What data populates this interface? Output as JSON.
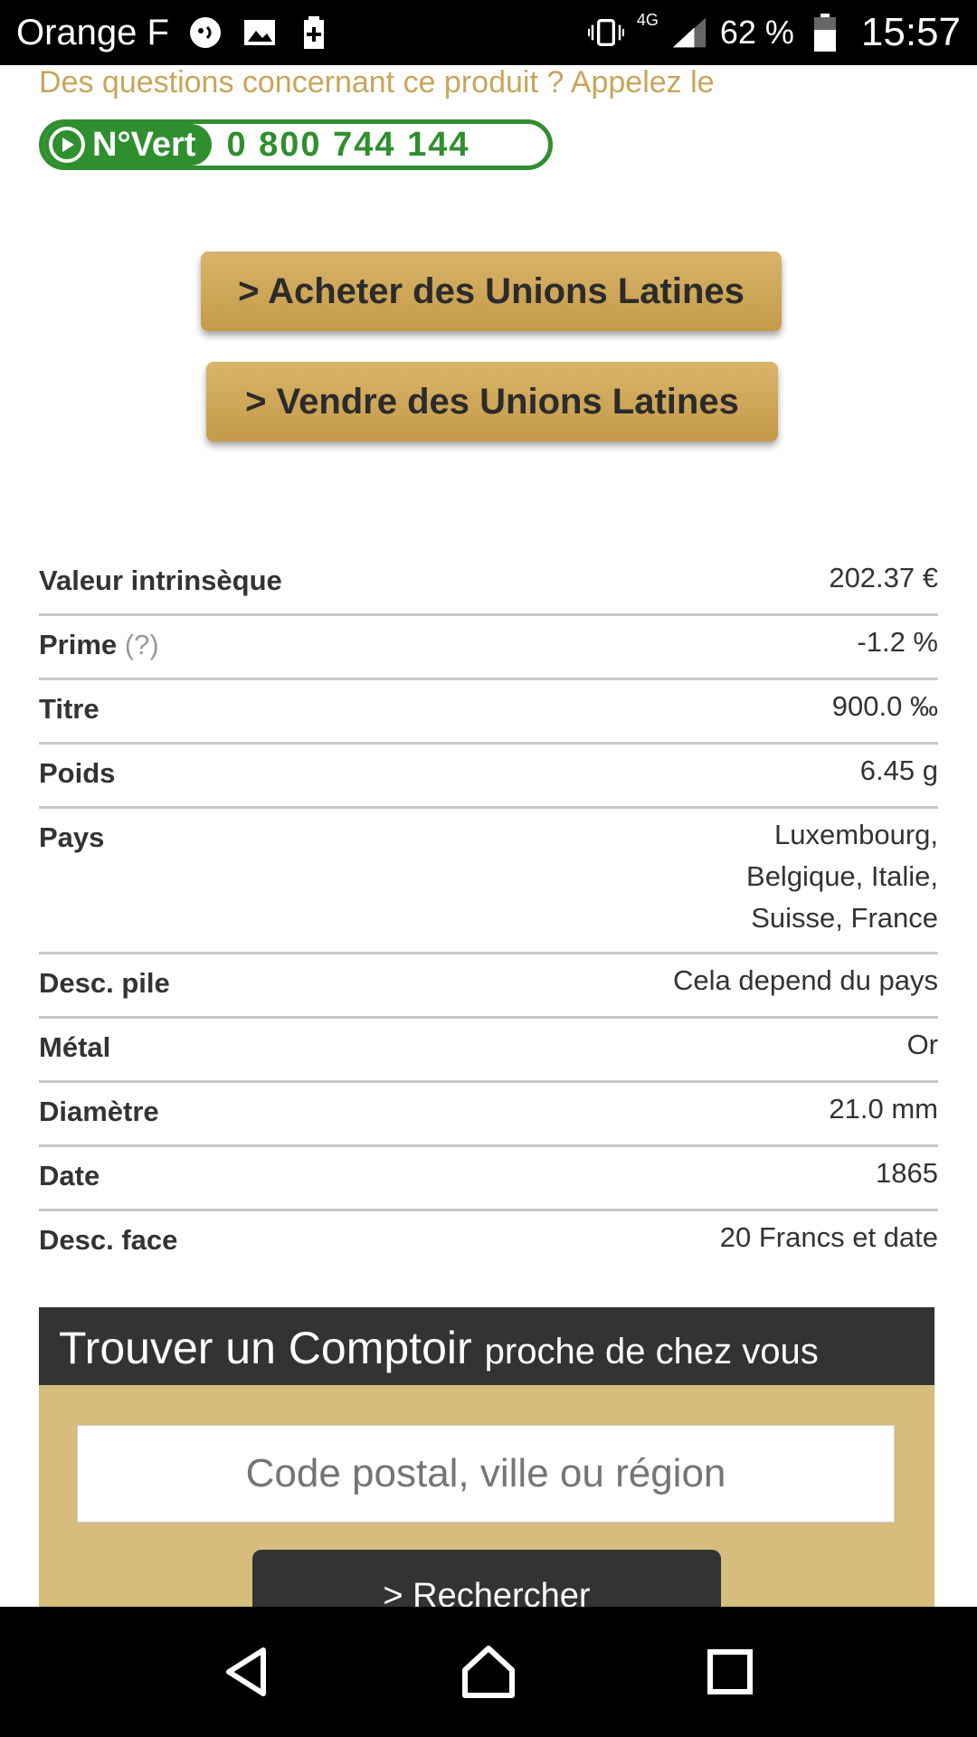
{
  "status_bar": {
    "carrier": "Orange F",
    "network": "4G",
    "battery": "62 %",
    "time": "15:57",
    "icons": [
      "messenger-icon",
      "image-icon",
      "battery-saver-icon",
      "vibrate-icon",
      "signal-icon",
      "battery-icon"
    ]
  },
  "header": {
    "question": "Des questions concernant ce produit ? Appelez le",
    "novert_label": "N°Vert",
    "novert_number": "0 800 744 144"
  },
  "actions": {
    "buy": "> Acheter des Unions Latines",
    "sell": "> Vendre des Unions Latines"
  },
  "specs": [
    {
      "label": "Valeur intrinsèque",
      "value": "202.37 €"
    },
    {
      "label": "Prime",
      "hint": "(?)",
      "value": "-1.2 %"
    },
    {
      "label": "Titre",
      "value": "900.0 ‰"
    },
    {
      "label": "Poids",
      "value": "6.45 g"
    },
    {
      "label": "Pays",
      "value_lines": [
        "Luxembourg,",
        "Belgique, Italie,",
        "Suisse, France"
      ]
    },
    {
      "label": "Desc. pile",
      "value": "Cela depend du pays"
    },
    {
      "label": "Métal",
      "value": "Or"
    },
    {
      "label": "Diamètre",
      "value": "21.0 mm"
    },
    {
      "label": "Date",
      "value": "1865"
    },
    {
      "label": "Desc. face",
      "value": "20 Francs et date"
    }
  ],
  "comptoir": {
    "title": "Trouver un Comptoir",
    "subtitle": "proche de chez vous",
    "input_placeholder": "Code postal, ville ou région",
    "search_label": "> Rechercher"
  },
  "nav": {
    "icons": [
      "back-icon",
      "home-icon",
      "recents-icon"
    ]
  },
  "colors": {
    "gold": "#c9a55a",
    "green": "#2f8f2f",
    "dark": "#333333",
    "panel": "#d6bd7e"
  }
}
